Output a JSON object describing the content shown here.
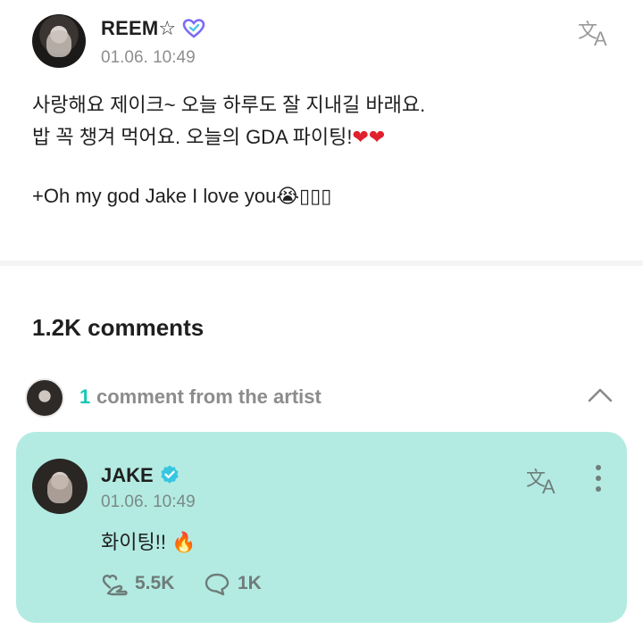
{
  "post": {
    "author": "REEM☆",
    "timestamp": "01.06. 10:49",
    "lines": [
      "사랑해요 제이크~ 오늘 하루도 잘 지내길 바래요.",
      "밥 꼭 챙겨 먹어요. 오늘의 GDA 파이팅!",
      "+Oh my god Jake I love you"
    ],
    "line2_emoji": "❤❤",
    "line3_emoji": "😭",
    "line3_tail": "▯▯▯"
  },
  "comments": {
    "count_label": "1.2K comments"
  },
  "artist_comments": {
    "count": "1",
    "label": "comment from the artist"
  },
  "comment": {
    "author": "JAKE",
    "timestamp": "01.06. 10:49",
    "text": "화이팅!!",
    "emoji": "🔥",
    "likes": "5.5K",
    "replies": "1K"
  },
  "colors": {
    "accent": "#1ac7b5",
    "card_background": "#b3ebe2",
    "verified_heart": "#7b6cf6"
  },
  "icons": {
    "translate": "translate-icon",
    "more": "more-vertical-icon",
    "like": "heart-hand-icon",
    "reply": "speech-bubble-icon",
    "collapse": "chevron-up-icon"
  }
}
